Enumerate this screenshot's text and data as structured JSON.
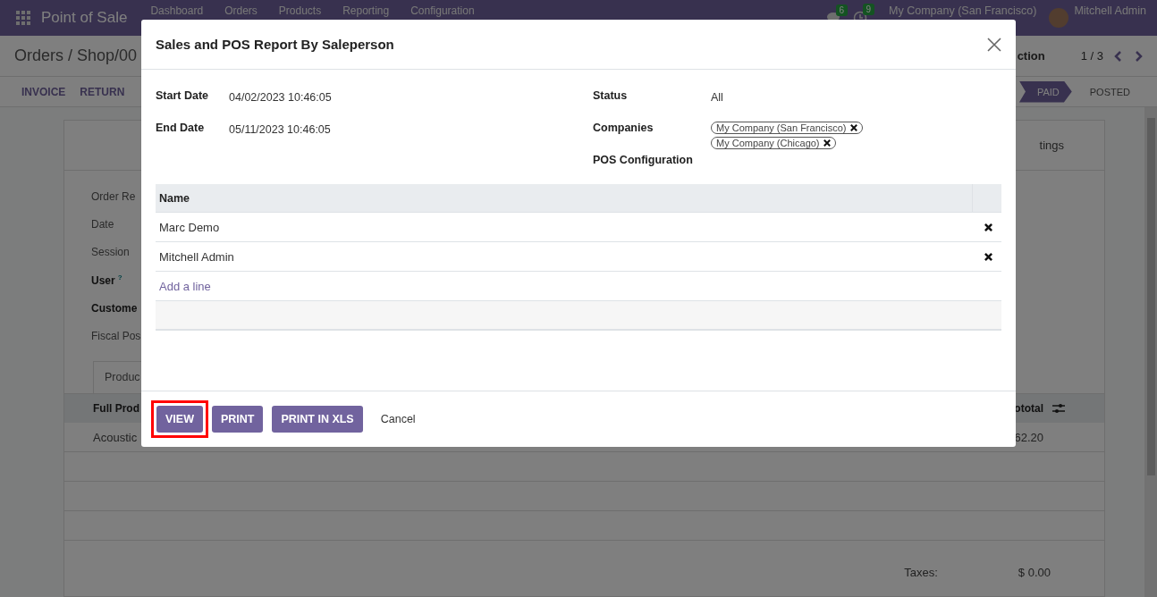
{
  "navbar": {
    "app_name": "Point of Sale",
    "menu": [
      "Dashboard",
      "Orders",
      "Products",
      "Reporting",
      "Configuration"
    ],
    "messages_count": "6",
    "activities_count": "9",
    "company": "My Company (San Francisco)",
    "user": "Mitchell Admin"
  },
  "control_panel": {
    "breadcrumb": "Orders / Shop/00",
    "action": "ction",
    "pager": "1 / 3"
  },
  "statusbar": {
    "buttons": [
      "INVOICE",
      "RETURN"
    ],
    "stages": [
      {
        "label": "PAID",
        "selected": true
      },
      {
        "label": "POSTED",
        "selected": false
      }
    ]
  },
  "sheet": {
    "tab_fragment": "tings",
    "fields": [
      {
        "label": "Order Re",
        "bold": false
      },
      {
        "label": "Date",
        "bold": false
      },
      {
        "label": "Session",
        "bold": false
      },
      {
        "label": "User",
        "bold": true,
        "help": "?"
      },
      {
        "label": "Custome",
        "bold": true
      },
      {
        "label": "Fiscal Pos",
        "bold": false
      }
    ],
    "notebook_tab": "Produc",
    "columns": [
      "Full Prod",
      "ototal"
    ],
    "rows": [
      [
        "Acoustic",
        "62.20"
      ]
    ],
    "taxes_label": "Taxes:",
    "taxes_value": "$ 0.00"
  },
  "dialog": {
    "title": "Sales and POS Report By Saleperson",
    "left_fields": [
      {
        "label": "Start Date",
        "value": "04/02/2023 10:46:05"
      },
      {
        "label": "End Date",
        "value": "05/11/2023 10:46:05"
      }
    ],
    "status_label": "Status",
    "status_value": "All",
    "companies_label": "Companies",
    "companies": [
      "My Company (San Francisco)",
      "My Company (Chicago)"
    ],
    "pos_label": "POS Configuration",
    "table_header": "Name",
    "rows": [
      "Marc Demo",
      "Mitchell Admin"
    ],
    "add_line": "Add a line",
    "buttons": [
      {
        "label": "VIEW",
        "kind": "primary",
        "highlighted": true
      },
      {
        "label": "PRINT",
        "kind": "primary",
        "highlighted": false
      },
      {
        "label": "PRINT IN XLS",
        "kind": "primary",
        "highlighted": false
      },
      {
        "label": "Cancel",
        "kind": "link",
        "highlighted": false
      }
    ]
  }
}
